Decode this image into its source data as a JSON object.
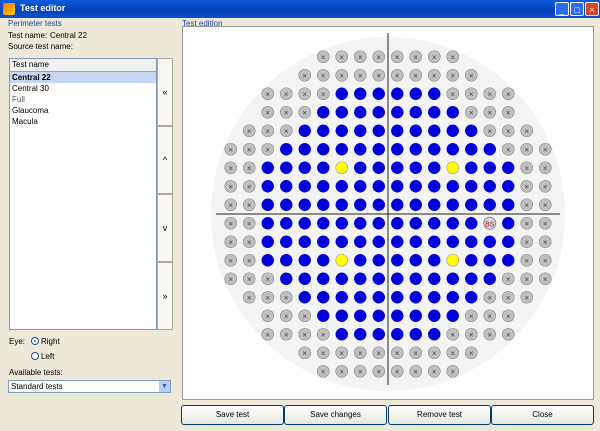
{
  "window": {
    "title": "Test editor",
    "controls": [
      "minimize-icon",
      "maximize-icon",
      "close-icon"
    ]
  },
  "left": {
    "group_label": "Perimeter tests",
    "test_name_label": "Test name:",
    "test_name_value": "Central 22",
    "source_label": "Source test name:",
    "list": {
      "header": "Test name",
      "items": [
        "Central 22",
        "Central 30",
        "Full",
        "Glaucoma",
        "Macula"
      ],
      "selected": "Central 22"
    },
    "side_buttons": [
      "«",
      "^",
      "v",
      "»"
    ],
    "eye_label": "Eye:",
    "eye_options": [
      "Right",
      "Left"
    ],
    "eye_selected": "Right",
    "available_label": "Available tests:",
    "available_value": "Standard tests"
  },
  "right": {
    "group_label": "Test edition",
    "blind_spot_label": "BS"
  },
  "buttons": {
    "save_test": "Save test",
    "save_changes": "Save changes",
    "remove_test": "Remove test",
    "close": "Close"
  },
  "colors": {
    "active_point": "#0000d8",
    "fixation_point": "#ffff00",
    "disabled_point": "#c0c0c0",
    "title_bar": "#0a5bdb"
  }
}
